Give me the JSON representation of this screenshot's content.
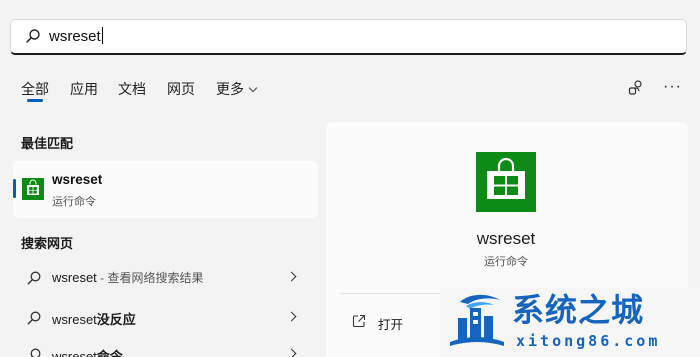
{
  "search": {
    "query": "wsreset"
  },
  "tabs": [
    {
      "label": "全部",
      "active": true
    },
    {
      "label": "应用"
    },
    {
      "label": "文档"
    },
    {
      "label": "网页"
    },
    {
      "label": "更多"
    }
  ],
  "best_match": {
    "section_title": "最佳匹配",
    "name": "wsreset",
    "subtitle": "运行命令",
    "icon": "store-icon"
  },
  "web_search": {
    "section_title": "搜索网页",
    "results": [
      {
        "prefix": "wsreset",
        "suffix": " - 查看网络搜索结果"
      },
      {
        "prefix": "wsreset",
        "suffix": "没反应"
      },
      {
        "prefix": "wsreset",
        "suffix": "命令"
      }
    ]
  },
  "detail": {
    "name": "wsreset",
    "subtitle": "运行命令",
    "actions": [
      {
        "label": "打开",
        "icon": "open-external-icon"
      }
    ]
  },
  "watermark": {
    "title": "系统之城",
    "url": "xitong86.com"
  },
  "colors": {
    "accent": "#005fb8",
    "store_green": "#0e8a16",
    "watermark_blue": "#1565c0"
  }
}
